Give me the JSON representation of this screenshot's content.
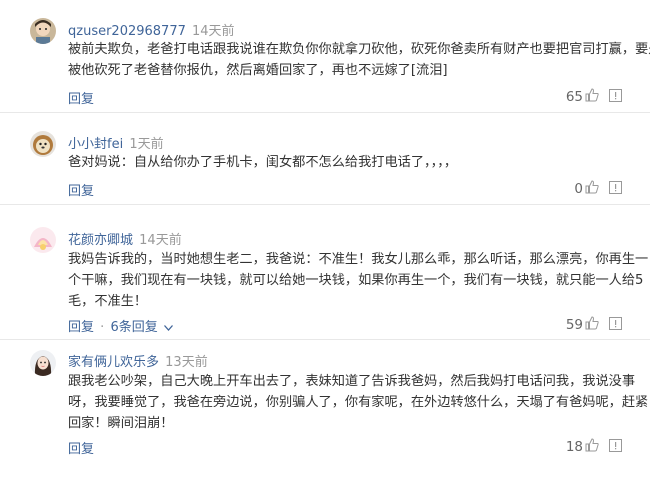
{
  "comments": [
    {
      "username": "qzuser202968777",
      "time": "14天前",
      "lines": [
        "被前夫欺负，老爸打电话跟我说谁在欺负你你就拿刀砍他，砍死你爸卖所有财产也要把官司打赢，要是",
        "被他砍死了老爸替你报仇，然后离婚回家了，再也不远嫁了[流泪]"
      ],
      "reply": "回复",
      "likes": "65"
    },
    {
      "username": "小小封fei",
      "time": "1天前",
      "lines": [
        "爸对妈说：自从给你办了手机卡，闺女都不怎么给我打电话了，，，，"
      ],
      "reply": "回复",
      "likes": "0"
    },
    {
      "username": "花颜亦卿城",
      "time": "14天前",
      "lines": [
        "我妈告诉我的，当时她想生老二，我爸说：不准生！我女儿那么乖，那么听话，那么漂亮，你再生一",
        "个干嘛，我们现在有一块钱，就可以给她一块钱，如果你再生一个，我们有一块钱，就只能一人给5",
        "毛，不准生！"
      ],
      "reply": "回复",
      "separator": "·",
      "replies_count": "6条回复",
      "likes": "59"
    },
    {
      "username": "家有俩儿欢乐多",
      "time": "13天前",
      "lines": [
        "跟我老公吵架，自己大晚上开车出去了，表妹知道了告诉我爸妈，然后我妈打电话问我，我说没事",
        "呀，我要睡觉了，我爸在旁边说，你别骗人了，你有家呢，在外边转悠什么，天塌了有爸妈呢，赶紧",
        "回家！瞬间泪崩！"
      ],
      "reply": "回复",
      "likes": "18"
    }
  ],
  "icons": {
    "thumb": "thumbs-up-icon",
    "report": "report-icon",
    "chevron": "chevron-down-icon"
  },
  "colors": {
    "username": "#406599",
    "link": "#406599",
    "muted": "#999999",
    "text": "#333333"
  }
}
